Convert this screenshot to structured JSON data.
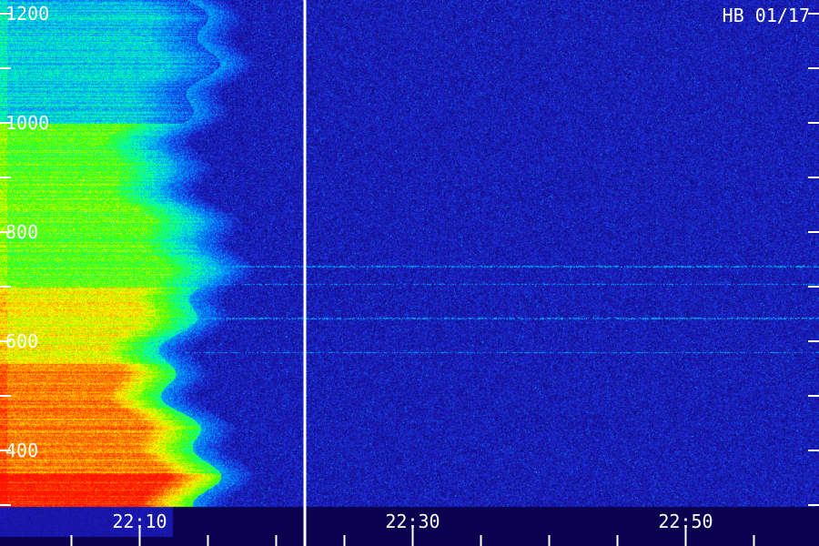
{
  "chart_data": {
    "type": "heatmap",
    "title": "HB 01/17",
    "y_tick_labels": [
      "1200",
      "1000",
      "800",
      "600",
      "400"
    ],
    "y_tick_values": [
      1200,
      1000,
      800,
      600,
      400
    ],
    "ylim": [
      280,
      1200
    ],
    "x_tick_labels": [
      "22:10",
      "22:30",
      "22:50"
    ],
    "x_tick_minutes": [
      10,
      30,
      50
    ],
    "xlim_minutes": [
      -0.1,
      59.9
    ],
    "x_origin": "22:00",
    "event_marker_minute": 22.1,
    "emission_cutoff_minute": 13.5,
    "emission_bands": [
      {
        "y_low": 280,
        "y_high": 360,
        "level": "max"
      },
      {
        "y_low": 360,
        "y_high": 460,
        "level": "high"
      },
      {
        "y_low": 460,
        "y_high": 560,
        "level": "high"
      },
      {
        "y_low": 560,
        "y_high": 700,
        "level": "medium-high"
      },
      {
        "y_low": 700,
        "y_high": 820,
        "level": "medium"
      },
      {
        "y_low": 820,
        "y_high": 1000,
        "level": "medium"
      },
      {
        "y_low": 1000,
        "y_high": 1200,
        "level": "low"
      }
    ],
    "interference_lines_y": [
      737,
      705,
      642,
      580
    ],
    "colormap": [
      "#0a0050",
      "#1e1ecc",
      "#0090ff",
      "#00ffc0",
      "#40ff00",
      "#ffff00",
      "#ff8000",
      "#ff1000"
    ]
  }
}
